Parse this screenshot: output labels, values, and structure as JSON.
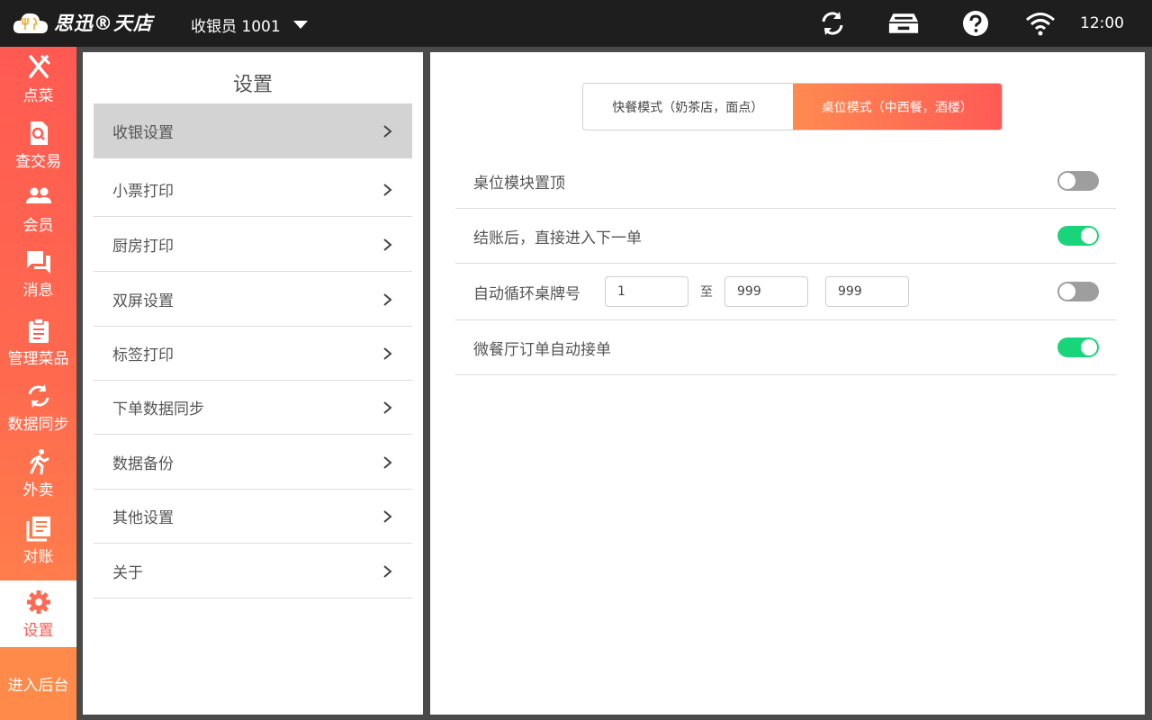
{
  "topbar": {
    "logo_text": "思迅®天店",
    "cashier": "收银员 1001",
    "time": "12:00",
    "icons": [
      "sync-icon",
      "cash-drawer-icon",
      "help-icon",
      "wifi-icon"
    ]
  },
  "sidenav": {
    "items": [
      {
        "label": "点菜",
        "icon": "utensils-icon"
      },
      {
        "label": "查交易",
        "icon": "search-document-icon"
      },
      {
        "label": "会员",
        "icon": "members-icon"
      },
      {
        "label": "消息",
        "icon": "message-icon"
      },
      {
        "label": "管理菜品",
        "icon": "clipboard-icon"
      },
      {
        "label": "数据同步",
        "icon": "sync-icon"
      },
      {
        "label": "外卖",
        "icon": "runner-icon"
      },
      {
        "label": "对账",
        "icon": "ledger-icon"
      },
      {
        "label": "设置",
        "icon": "gear-icon"
      }
    ],
    "active": "设置",
    "backend": "进入后台"
  },
  "settings_list": {
    "title": "设置",
    "items": [
      "收银设置",
      "小票打印",
      "厨房打印",
      "双屏设置",
      "标签打印",
      "下单数据同步",
      "数据备份",
      "其他设置",
      "关于"
    ],
    "selected": "收银设置",
    "chevron": ">"
  },
  "content": {
    "modes": [
      "快餐模式（奶茶店，面点）",
      "桌位模式（中西餐，酒楼）"
    ],
    "active_mode": "桌位模式（中西餐，酒楼）",
    "rows": [
      {
        "label": "桌位模块置顶",
        "enabled": false
      },
      {
        "label": "结账后，直接进入下一单",
        "enabled": true
      },
      {
        "label": "自动循环桌牌号",
        "enabled": false,
        "from": "1",
        "to_label": "至",
        "to": "999",
        "extra": "999"
      },
      {
        "label": "微餐厅订单自动接单",
        "enabled": true
      }
    ]
  },
  "colors": {
    "accent": "#ff5a52",
    "toggle_on": "#19d57a",
    "toggle_off": "#9e9e9e"
  }
}
